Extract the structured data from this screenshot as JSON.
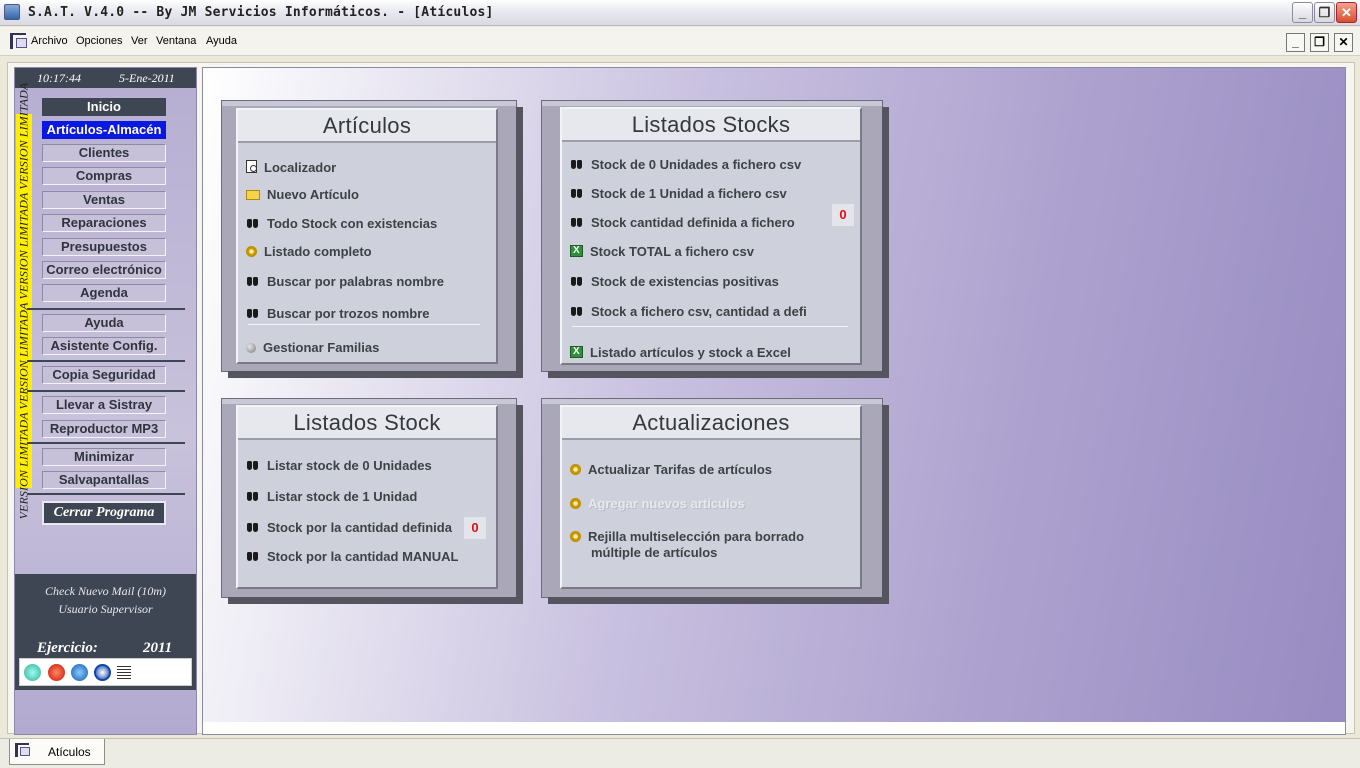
{
  "window": {
    "title": "S.A.T. V.4.0 -- By JM Servicios Informáticos. - [Atículos]",
    "minimize": "_",
    "restore": "❐",
    "close": "✕"
  },
  "menu": {
    "items": [
      "Archivo",
      "Opciones",
      "Ver",
      "Ventana",
      "Ayuda"
    ],
    "mdi_minimize": "_",
    "mdi_restore": "❐",
    "mdi_close": "✕"
  },
  "sidebar": {
    "time": "10:17:44",
    "date": "5-Ene-2011",
    "stripe_text": "VERSION LIMITADA   VERSION LIMITADA   VERSION LIMITADA   VERSION LIMITADA",
    "nav": [
      "Inicio",
      "Artículos-Almacén",
      "Clientes",
      "Compras",
      "Ventas",
      "Reparaciones",
      "Presupuestos",
      "Correo electrónico",
      "Agenda",
      "Ayuda",
      "Asistente Config.",
      "Copia Seguridad",
      "Llevar a Sistray",
      "Reproductor MP3",
      "Minimizar",
      "Salvapantallas",
      "Cerrar Programa"
    ],
    "mail_check": "Check Nuevo Mail (10m)",
    "user": "Usuario Supervisor",
    "ejercicio_label": "Ejercicio:",
    "ejercicio_value": "2011"
  },
  "cards": {
    "articulos": {
      "title": "Artículos",
      "items": [
        "Localizador",
        "Nuevo Artículo",
        "Todo Stock con existencias",
        "Listado completo",
        "Buscar por palabras nombre",
        "Buscar por trozos nombre",
        "Gestionar Familias"
      ]
    },
    "listados_stocks": {
      "title": "Listados Stocks",
      "items": [
        "Stock de 0 Unidades a fichero csv",
        "Stock de 1 Unidad a fichero csv",
        "Stock cantidad definida a fichero",
        "Stock TOTAL a fichero csv",
        "Stock de existencias positivas",
        "Stock a fichero csv, cantidad a defi",
        "Listado artículos y stock a Excel"
      ],
      "counter": "0"
    },
    "listados_stock": {
      "title": "Listados Stock",
      "items": [
        "Listar stock de 0 Unidades",
        "Listar stock de 1 Unidad",
        "Stock por la cantidad definida",
        "Stock por la cantidad MANUAL"
      ],
      "counter": "0"
    },
    "actualizaciones": {
      "title": "Actualizaciones",
      "items": [
        "Actualizar Tarifas de artículos",
        "Agregar nuevos artículos",
        "Rejilla multiselección para borrado",
        "múltiple de artículos"
      ]
    }
  },
  "tabs": [
    "Atículos"
  ],
  "icons": {
    "binoculars": "binoculars-icon",
    "gear": "gear-icon",
    "excel": "excel-icon"
  }
}
